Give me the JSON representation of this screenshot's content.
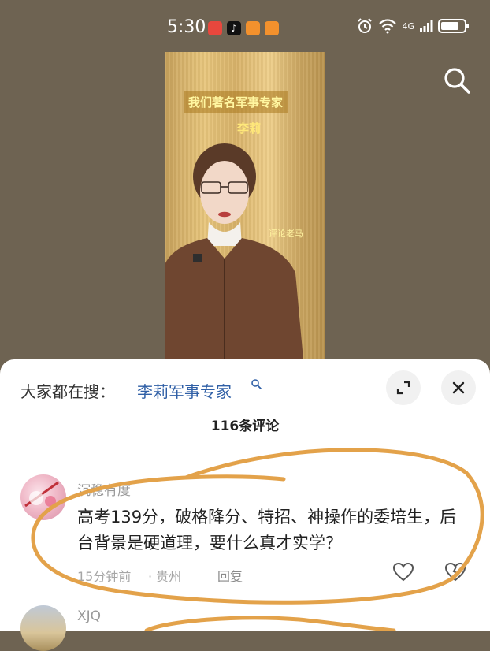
{
  "status_bar": {
    "time": "5:30",
    "network_label": "4G",
    "battery_level_percent": 80,
    "icons": [
      "red-app-icon",
      "tiktok-icon",
      "orange-app-icon",
      "orange-app-icon",
      "alarm-icon",
      "wifi-icon",
      "signal-icon",
      "battery-icon"
    ]
  },
  "video": {
    "caption_line1": "我们著名军事专家",
    "caption_name": "李莉",
    "caption_credit": "评论老马"
  },
  "comments_sheet": {
    "hot_search_prefix": "大家都在搜：",
    "hot_search_term": "李莉军事专家",
    "comment_count": "116条评论",
    "comments": [
      {
        "user": "沉稳有度",
        "text": "高考139分，破格降分、特招、神操作的委培生，后台背景是硬道理，要什么真才实学？",
        "time": "15分钟前",
        "location": "· 贵州",
        "reply_label": "回复"
      },
      {
        "user": "XJQ"
      }
    ]
  },
  "colors": {
    "background": "#6e6352",
    "link": "#2f5fa6",
    "annotation_circle": "#e3a24a"
  }
}
